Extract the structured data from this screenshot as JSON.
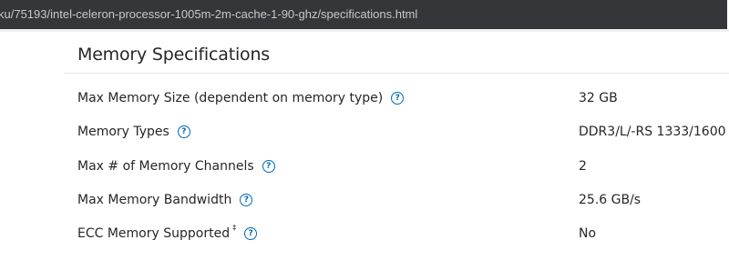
{
  "browser": {
    "url": "ku/75193/intel-celeron-processor-1005m-2m-cache-1-90-ghz/specifications.html"
  },
  "section": {
    "title": "Memory Specifications"
  },
  "specs": [
    {
      "label": "Max Memory Size (dependent on memory type)",
      "value": "32 GB",
      "footnote": ""
    },
    {
      "label": "Memory Types",
      "value": "DDR3/L/-RS 1333/1600",
      "footnote": ""
    },
    {
      "label": "Max # of Memory Channels",
      "value": "2",
      "footnote": ""
    },
    {
      "label": "Max Memory Bandwidth",
      "value": "25.6 GB/s",
      "footnote": ""
    },
    {
      "label": "ECC Memory Supported",
      "value": "No",
      "footnote": "‡"
    }
  ],
  "help_icon_glyph": "?",
  "colors": {
    "link_blue": "#0068b5",
    "text": "#262626",
    "url_bar_bg": "#35363a"
  }
}
